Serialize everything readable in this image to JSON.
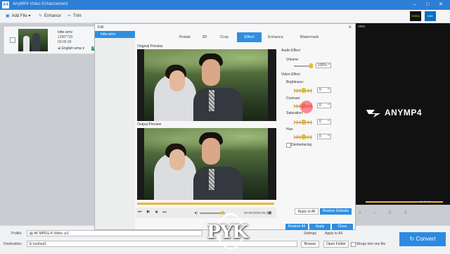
{
  "app": {
    "title": "AnyMP4 Video Enhancement",
    "logo_text": "A4",
    "window_buttons": "–  □  ✕"
  },
  "toolbar": {
    "add_file": "Add File",
    "enhance": "Enhance",
    "trim": "Trim"
  },
  "badges": {
    "nvidia": "NVIDIA",
    "intel": "intel"
  },
  "file": {
    "name": "lotte.wmv",
    "resolution": "1280*720",
    "duration": "00:05:39",
    "audio": "English wma"
  },
  "preview": {
    "label": "view",
    "brand": "ANYMP4",
    "time": "00:05:39",
    "progress": 1.0
  },
  "dialog": {
    "title": "Edit",
    "sidebar_file": "lotte.wmv",
    "tabs": [
      "Rotate",
      "3D",
      "Crop",
      "Effect",
      "Enhance",
      "Watermark"
    ],
    "active_tab": "Effect",
    "original_label": "Original Preview",
    "output_label": "Output Preview",
    "player": {
      "time": "00:00:00/00:05:39",
      "progress": 1.0
    },
    "audio_effect": "Audio Effect",
    "volume_label": "Volume:",
    "volume_value": "100%",
    "video_effect": "Video Effect",
    "brightness_label": "Brightness:",
    "brightness_value": "0",
    "contrast_label": "Contrast:",
    "contrast_value": "0",
    "saturation_label": "Saturation:",
    "saturation_value": "0",
    "hue_label": "Hue:",
    "hue_value": "0",
    "deinterlacing_label": "Deinterlacing",
    "apply_all": "Apply to All",
    "restore_defaults": "Restore Defaults",
    "restore_all": "Restore All",
    "apply": "Apply",
    "close": "Close"
  },
  "bottom": {
    "profile_label": "Profile:",
    "profile_value": "4K MPEG-4 Video -p1",
    "settings": "Settings",
    "apply_to_all": "Apply to All",
    "destination_label": "Destination:",
    "destination_value": "E:\\out\\out1",
    "browse": "Browse",
    "open_folder": "Open Folder",
    "merge": "Merge into one file",
    "convert": "Convert"
  },
  "watermark": "PYK",
  "colors": {
    "accent": "#2f8ee0",
    "slider": "#e8b830",
    "titlebar": "#2d7fd6"
  }
}
